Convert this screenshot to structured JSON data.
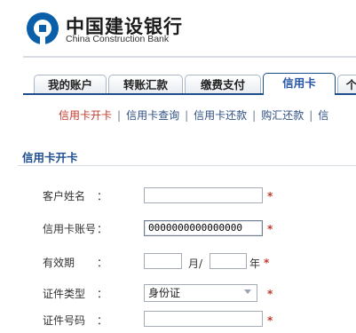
{
  "brand": {
    "name_cn": "中国建设银行",
    "name_en": "China Construction Bank"
  },
  "nav": {
    "tabs": [
      {
        "label": "我的账户"
      },
      {
        "label": "转账汇款"
      },
      {
        "label": "缴费支付"
      },
      {
        "label": "信用卡"
      },
      {
        "label": "个"
      }
    ],
    "active_tab": "信用卡"
  },
  "subnav": {
    "items": [
      {
        "label": "信用卡开卡"
      },
      {
        "label": "信用卡查询"
      },
      {
        "label": "信用卡还款"
      },
      {
        "label": "购汇还款"
      },
      {
        "label": "信"
      }
    ],
    "separator": "|"
  },
  "section": {
    "title": "信用卡开卡"
  },
  "form": {
    "colon": "：",
    "required_mark": "*",
    "name": {
      "label": "客户姓名",
      "value": ""
    },
    "card": {
      "label": "信用卡账号",
      "value": "0000000000000000"
    },
    "expiry": {
      "label": "有效期",
      "month_unit": "月/",
      "year_unit": "年",
      "month_value": "",
      "year_value": ""
    },
    "id_type": {
      "label": "证件类型",
      "value": "身份证"
    },
    "id_number": {
      "label": "证件号码",
      "value": ""
    }
  }
}
